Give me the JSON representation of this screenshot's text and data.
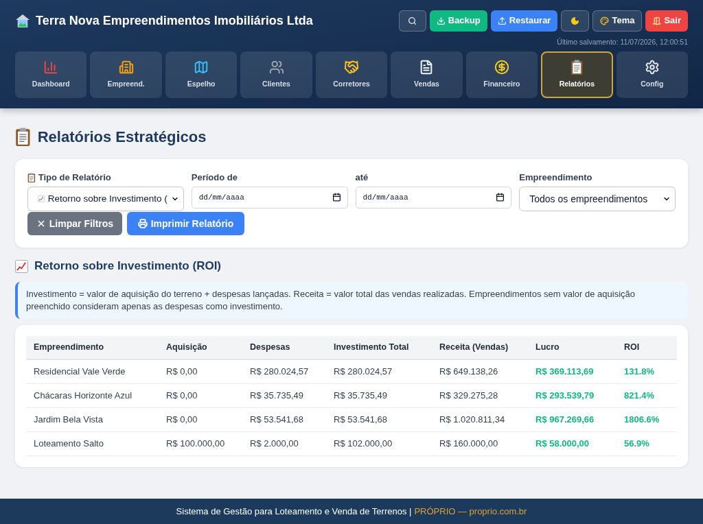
{
  "header": {
    "title": "Terra Nova Empreendimentos Imobiliários Ltda",
    "buttons": [
      {
        "kind": "search"
      },
      {
        "kind": "backup",
        "label": "Backup"
      },
      {
        "kind": "restore",
        "label": "Restaurar"
      },
      {
        "kind": "dark-mode"
      },
      {
        "kind": "theme",
        "label": "Tema"
      },
      {
        "kind": "logout",
        "label": "Sair"
      }
    ],
    "last_saved": "Último salvamento: 11/07/2026, 12:00:51"
  },
  "nav": [
    {
      "label": "Dashboard",
      "selected": false
    },
    {
      "label": "Empreend.",
      "selected": false
    },
    {
      "label": "Espelho",
      "selected": false
    },
    {
      "label": "Clientes",
      "selected": false
    },
    {
      "label": "Corretores",
      "selected": false
    },
    {
      "label": "Vendas",
      "selected": false
    },
    {
      "label": "Financeiro",
      "selected": false
    },
    {
      "label": "Relatórios",
      "selected": true
    },
    {
      "label": "Config",
      "selected": false
    }
  ],
  "page_title": "Relatórios Estratégicos",
  "filters": {
    "report_type": {
      "label": "Tipo de Relatório",
      "value": "Retorno sobre Investimento ("
    },
    "period_from": {
      "label": "Período de",
      "placeholder": "dd/mm/aaaa"
    },
    "period_to": {
      "label": "até",
      "placeholder": "dd/mm/aaaa"
    },
    "development": {
      "label": "Empreendimento",
      "value": "Todos os empreendimentos"
    },
    "buttons": [
      {
        "kind": "clear",
        "label": "Limpar Filtros"
      },
      {
        "kind": "print",
        "label": "Imprimir Relatório"
      }
    ]
  },
  "section_title": "Retorno sobre Investimento (ROI)",
  "info": "Investimento = valor de aquisição do terreno + despesas lançadas. Receita = valor total das vendas realizadas. Empreendimentos sem valor de aquisição preenchido consideram apenas as despesas como investimento.",
  "table": {
    "columns": [
      "Empreendimento",
      "Aquisição",
      "Despesas",
      "Investimento Total",
      "Receita (Vendas)",
      "Lucro",
      "ROI"
    ],
    "rows": [
      [
        "Residencial Vale Verde",
        "R$ 0,00",
        "R$ 280.024,57",
        "R$ 280.024,57",
        "R$ 649.138,26",
        "R$ 369.113,69",
        "131.8%"
      ],
      [
        "Chácaras Horizonte Azul",
        "R$ 0,00",
        "R$ 35.735,49",
        "R$ 35.735,49",
        "R$ 329.275,28",
        "R$ 293.539,79",
        "821.4%"
      ],
      [
        "Jardim Bela Vista",
        "R$ 0,00",
        "R$ 53.541,68",
        "R$ 53.541,68",
        "R$ 1.020.811,34",
        "R$ 967.269,66",
        "1806.6%"
      ],
      [
        "Loteamento Salto",
        "R$ 100.000,00",
        "R$ 2.000,00",
        "R$ 102.000,00",
        "R$ 160.000,00",
        "R$ 58.000,00",
        "56.9%"
      ]
    ]
  },
  "footer": {
    "text": "Sistema de Gestão para Loteamento e Venda de Terrenos |",
    "link": "PRÓPRIO — proprio.com.br"
  }
}
